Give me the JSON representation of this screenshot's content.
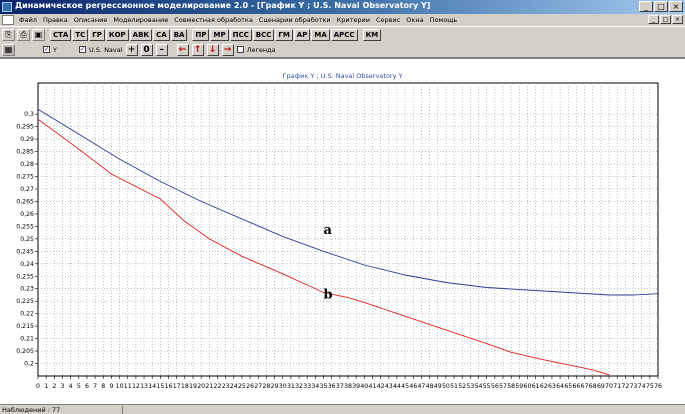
{
  "window": {
    "title": "Динамическое регрессионное моделирование 2.0 - [График Y ; U.S. Naval Observatory Y]",
    "controls": [
      "_",
      "□",
      "×"
    ]
  },
  "menu": {
    "items": [
      "Файл",
      "Правка",
      "Описание",
      "Моделирование",
      "Совместная обработка",
      "Сценарии обработки",
      "Критерии",
      "Сервис",
      "Окна",
      "Помощь"
    ],
    "mdi_controls": [
      "_",
      "□",
      "×"
    ]
  },
  "toolbar": {
    "buttons": [
      "СТА",
      "ТС",
      "ГР",
      "КОР",
      "АВК",
      "СА",
      "ВА",
      "ПР",
      "МР",
      "ПСС",
      "ВСС",
      "ГМ",
      "АР",
      "МА",
      "АРСС",
      "КМ"
    ]
  },
  "series_bar": {
    "y_label": "Y",
    "naval_label": "U.S. Naval",
    "plus": "+",
    "zero": "0",
    "minus": "–",
    "legend_label": "Легенда",
    "arrows": [
      "←",
      "↑",
      "↓",
      "→"
    ]
  },
  "chart_data": {
    "type": "line",
    "title": "График Y ; U.S. Naval Observatory Y",
    "xlabel": "",
    "ylabel": "",
    "xlim": [
      0,
      76
    ],
    "ylim": [
      0.195,
      0.3125
    ],
    "yticks": [
      "0,3",
      "0,295",
      "0,29",
      "0,285",
      "0,28",
      "0,275",
      "0,27",
      "0,265",
      "0,26",
      "0,255",
      "0,25",
      "0,245",
      "0,24",
      "0,235",
      "0,23",
      "0,225",
      "0,22",
      "0,215",
      "0,21",
      "0,205",
      "0,2"
    ],
    "ytick_values": [
      0.3,
      0.295,
      0.29,
      0.285,
      0.28,
      0.275,
      0.27,
      0.265,
      0.26,
      0.255,
      0.25,
      0.245,
      0.24,
      0.235,
      0.23,
      0.225,
      0.22,
      0.215,
      0.21,
      0.205,
      0.2
    ],
    "grid": true,
    "annotations": [
      {
        "text": "a",
        "x": 35,
        "y": 0.252
      },
      {
        "text": "b",
        "x": 35,
        "y": 0.226
      }
    ],
    "series": [
      {
        "color": "#2a3a9a",
        "x": [
          0,
          5,
          10,
          15,
          20,
          25,
          30,
          35,
          40,
          45,
          50,
          55,
          60,
          65,
          70,
          73,
          76
        ],
        "values": [
          0.302,
          0.292,
          0.282,
          0.273,
          0.265,
          0.258,
          0.251,
          0.245,
          0.2395,
          0.2355,
          0.2325,
          0.2305,
          0.2295,
          0.2285,
          0.2275,
          0.2275,
          0.228
        ]
      },
      {
        "color": "#e02020",
        "x": [
          0,
          5,
          9,
          12,
          15,
          18,
          21,
          25,
          30,
          33,
          35,
          38,
          40,
          45,
          50,
          55,
          58,
          62,
          65,
          68,
          70
        ],
        "values": [
          0.298,
          0.286,
          0.276,
          0.271,
          0.266,
          0.257,
          0.25,
          0.243,
          0.236,
          0.2315,
          0.2285,
          0.2265,
          0.2245,
          0.219,
          0.2135,
          0.208,
          0.2045,
          0.2015,
          0.1995,
          0.1975,
          0.1955
        ]
      }
    ]
  },
  "status": {
    "text": "Наблюдений : 77"
  }
}
